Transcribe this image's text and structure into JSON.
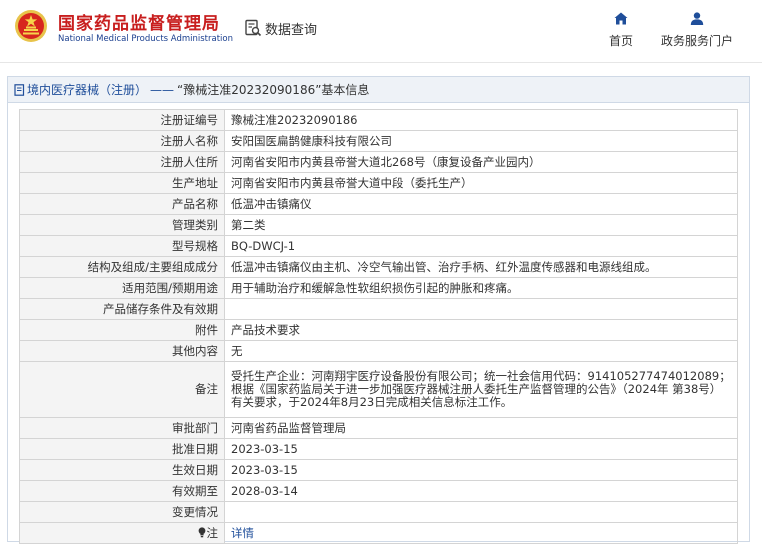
{
  "header": {
    "org_name_cn": "国家药品监督管理局",
    "org_name_en": "National Medical Products Administration",
    "data_query_label": "数据查询",
    "nav": [
      {
        "label": "首页",
        "icon": "home-icon"
      },
      {
        "label": "政务服务门户",
        "icon": "user-icon"
      }
    ]
  },
  "breadcrumb": {
    "category": "境内医疗器械（注册）",
    "separator": "——",
    "title": "“豫械注准20232090186”基本信息"
  },
  "fields": [
    {
      "label": "注册证编号",
      "value": "豫械注准20232090186"
    },
    {
      "label": "注册人名称",
      "value": "安阳国医扁鹊健康科技有限公司"
    },
    {
      "label": "注册人住所",
      "value": "河南省安阳市内黄县帝誉大道北268号（康复设备产业园内）"
    },
    {
      "label": "生产地址",
      "value": "河南省安阳市内黄县帝誉大道中段（委托生产）"
    },
    {
      "label": "产品名称",
      "value": "低温冲击镇痛仪"
    },
    {
      "label": "管理类别",
      "value": "第二类"
    },
    {
      "label": "型号规格",
      "value": "BQ-DWCJ-1"
    },
    {
      "label": "结构及组成/主要组成成分",
      "value": "低温冲击镇痛仪由主机、冷空气输出管、治疗手柄、红外温度传感器和电源线组成。"
    },
    {
      "label": "适用范围/预期用途",
      "value": "用于辅助治疗和缓解急性软组织损伤引起的肿胀和疼痛。"
    },
    {
      "label": "产品储存条件及有效期",
      "value": ""
    },
    {
      "label": "附件",
      "value": "产品技术要求"
    },
    {
      "label": "其他内容",
      "value": "无"
    },
    {
      "label": "备注",
      "value": "受托生产企业：河南翔宇医疗设备股份有限公司；统一社会信用代码：914105277474012089；根据《国家药监局关于进一步加强医疗器械注册人委托生产监督管理的公告》（2024年 第38号）有关要求，于2024年8月23日完成相关信息标注工作。"
    },
    {
      "label": "审批部门",
      "value": "河南省药品监督管理局"
    },
    {
      "label": "批准日期",
      "value": "2023-03-15"
    },
    {
      "label": "生效日期",
      "value": "2023-03-15"
    },
    {
      "label": "有效期至",
      "value": "2028-03-14"
    },
    {
      "label": "变更情况",
      "value": ""
    }
  ],
  "note_row": {
    "label": "注",
    "link": "详情"
  },
  "colors": {
    "brand_red": "#c81e1e",
    "brand_blue": "#1a3f8f",
    "link_blue": "#1f4e9a"
  }
}
